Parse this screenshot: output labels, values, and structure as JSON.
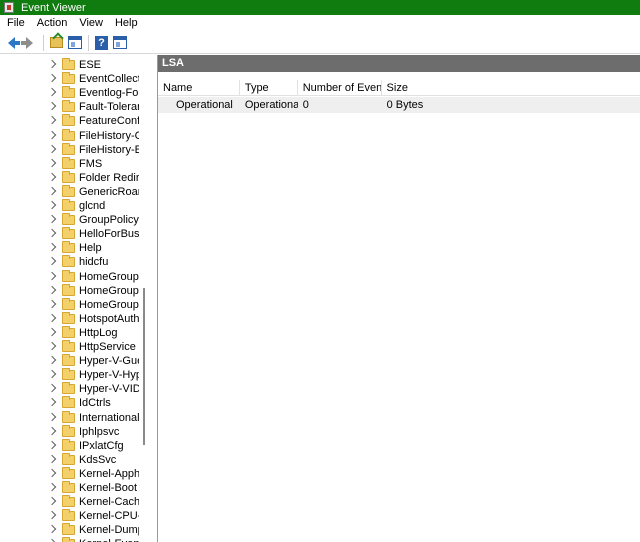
{
  "window": {
    "title": "Event Viewer"
  },
  "menu": {
    "items": [
      "File",
      "Action",
      "View",
      "Help"
    ]
  },
  "toolbar": {
    "icons": [
      "back-arrow-icon",
      "forward-arrow-icon",
      "folder-up-icon",
      "show-hide-tree-icon",
      "help-icon",
      "action-pane-icon"
    ],
    "help_glyph": "?"
  },
  "tree": {
    "items": [
      "ESE",
      "EventCollector",
      "Eventlog-Forw",
      "Fault-Tolerant-",
      "FeatureConfig",
      "FileHistory-Co",
      "FileHistory-Eng",
      "FMS",
      "Folder Redirect",
      "GenericRoamin",
      "glcnd",
      "GroupPolicy",
      "HelloForBusine",
      "Help",
      "hidcfu",
      "HomeGroup C",
      "HomeGroup-L",
      "HomeGroup-P",
      "HotspotAuth",
      "HttpLog",
      "HttpService",
      "Hyper-V-Guest",
      "Hyper-V-Hype",
      "Hyper-V-VID",
      "IdCtrls",
      "International-F",
      "Iphlpsvc",
      "IPxlatCfg",
      "KdsSvc",
      "Kernel-Apphel",
      "Kernel-Boot",
      "Kernel-Cache",
      "Kernel-CPU-St",
      "Kernel-Dump",
      "Kernel-EventTr"
    ]
  },
  "content": {
    "header": "LSA",
    "columns": [
      "Name",
      "Type",
      "Number of Events",
      "Size"
    ],
    "rows": [
      {
        "name": "Operational",
        "type": "Operational",
        "events": "0",
        "size": "0 Bytes"
      }
    ]
  }
}
